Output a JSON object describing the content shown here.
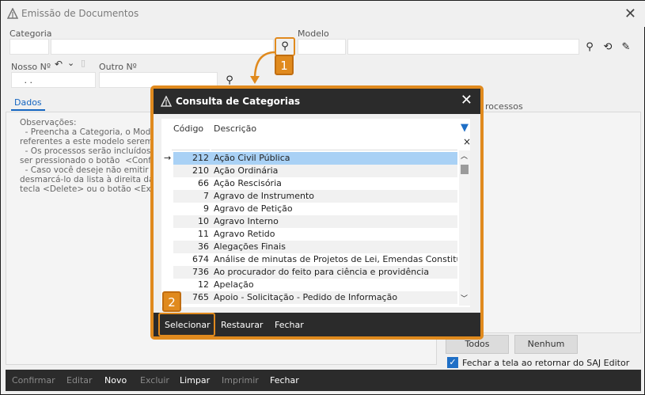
{
  "window": {
    "title": "Emissão de Documentos",
    "close_glyph": "✕"
  },
  "form": {
    "categoria_label": "Categoria",
    "modelo_label": "Modelo",
    "nosso_label": "Nosso Nº",
    "nosso_value": " . .",
    "outro_label": "Outro Nº"
  },
  "tabs": {
    "dados": "Dados"
  },
  "observacoes": "Observações:\n  - Preencha a Categoria, o Model\nreferentes a este modelo serem e\n  - Os processos serão incluídos n\nser pressionado o botão  <Confir\n  - Caso você deseje não emitir u\ndesmarcá-lo da lista à direita da\ntecla <Delete> ou o botão <Excl",
  "right_panel": {
    "processos_fragment": "rocessos",
    "todos": "Todos",
    "nenhum": "Nenhum",
    "fechar_tela": "Fechar a tela ao retornar do SAJ Editor"
  },
  "bottom_bar": {
    "confirmar": "Confirmar",
    "editar": "Editar",
    "novo": "Novo",
    "excluir": "Excluir",
    "limpar": "Limpar",
    "imprimir": "Imprimir",
    "fechar": "Fechar"
  },
  "modal": {
    "title": "Consulta de Categorias",
    "col_codigo": "Código",
    "col_descricao": "Descrição",
    "rows": [
      {
        "code": "212",
        "desc": "Ação Civil Pública"
      },
      {
        "code": "210",
        "desc": "Ação Ordinária"
      },
      {
        "code": "66",
        "desc": "Ação Rescisória"
      },
      {
        "code": "7",
        "desc": "Agravo de Instrumento"
      },
      {
        "code": "9",
        "desc": "Agravo de Petição"
      },
      {
        "code": "10",
        "desc": "Agravo Interno"
      },
      {
        "code": "11",
        "desc": "Agravo Retido"
      },
      {
        "code": "36",
        "desc": "Alegações Finais"
      },
      {
        "code": "674",
        "desc": "Análise de minutas de Projetos de Lei, Emendas Constitucionais"
      },
      {
        "code": "736",
        "desc": "Ao procurador do feito para ciência e providência"
      },
      {
        "code": "12",
        "desc": "Apelação"
      },
      {
        "code": "765",
        "desc": "Apoio - Solicitação - Pedido de Informação"
      }
    ],
    "selecionar": "Selecionar",
    "restaurar": "Restaurar",
    "fechar": "Fechar"
  },
  "callouts": {
    "one": "1",
    "two": "2"
  },
  "accent_color": "#e08a1e"
}
